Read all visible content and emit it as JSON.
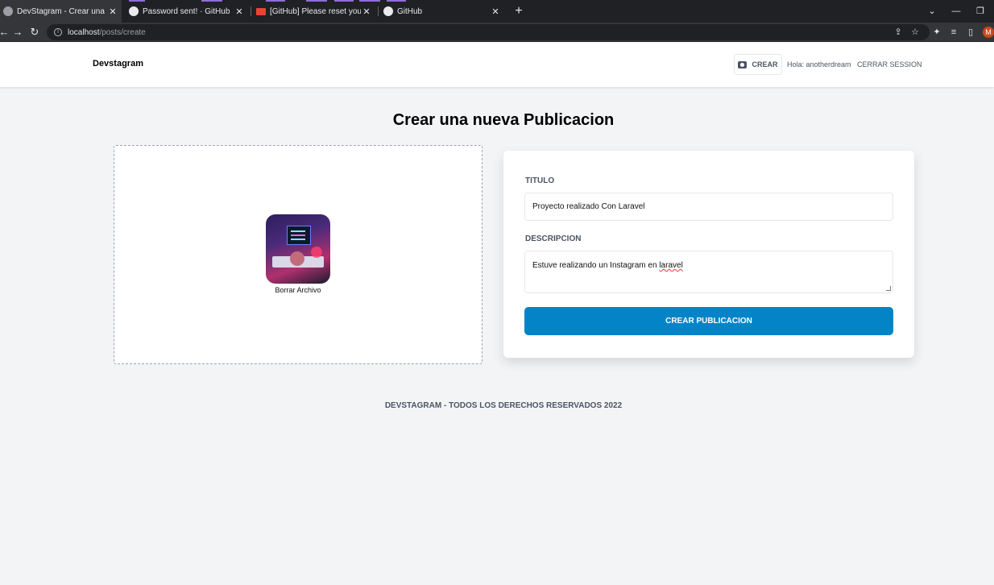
{
  "browser": {
    "tabs": [
      {
        "title": "DevStagram - Crear una nueva P",
        "active": true
      },
      {
        "title": "Password sent! · GitHub",
        "active": false
      },
      {
        "title": "[GitHub] Please reset your passw",
        "active": false
      },
      {
        "title": "GitHub",
        "active": false
      }
    ],
    "url_host": "localhost",
    "url_path": "/posts/create",
    "profile_initial": "M"
  },
  "header": {
    "brand": "Devstagram",
    "create_label": "CREAR",
    "greeting_prefix": "Hola: ",
    "username": "anotherdream",
    "logout_label": "CERRAR SESSION"
  },
  "main": {
    "title": "Crear una nueva Publicacion",
    "dropzone": {
      "remove_label": "Borrar Archivo"
    },
    "form": {
      "title_label": "TITULO",
      "title_value": "Proyecto realizado Con Laravel",
      "description_label": "DESCRIPCION",
      "description_value_prefix": "Estuve realizando un Instagram en ",
      "description_value_flagged": "laravel",
      "submit_label": "CREAR PUBLICACION"
    }
  },
  "footer": {
    "text": "DEVSTAGRAM - TODOS LOS DERECHOS RESERVADOS 2022"
  },
  "colors": {
    "accent": "#0284c7",
    "page_bg": "#f3f4f6",
    "profile": "#d0451b"
  }
}
